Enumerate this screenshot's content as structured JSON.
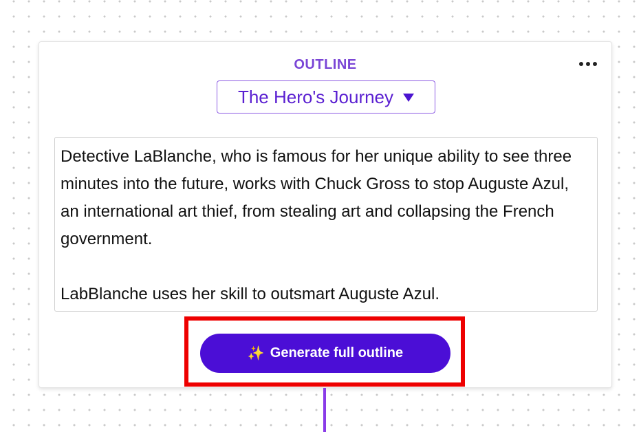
{
  "outline_card": {
    "label": "OUTLINE",
    "template_select": {
      "selected": "The Hero's Journey"
    },
    "premise_paragraph_1": "Detective LaBlanche, who is famous for her unique ability to see three minutes into the future, works with Chuck Gross to stop Auguste Azul, an international art thief, from stealing art and collapsing the French government.",
    "premise_paragraph_2": "LabBlanche uses her skill to outsmart Auguste Azul.",
    "generate_button": {
      "icon": "sparkles-icon",
      "label": "Generate full outline"
    }
  },
  "colors": {
    "accent": "#4b0ed6",
    "label_purple": "#7a45d6",
    "highlight_red": "#ee0000",
    "connector": "#8a3ce8"
  }
}
